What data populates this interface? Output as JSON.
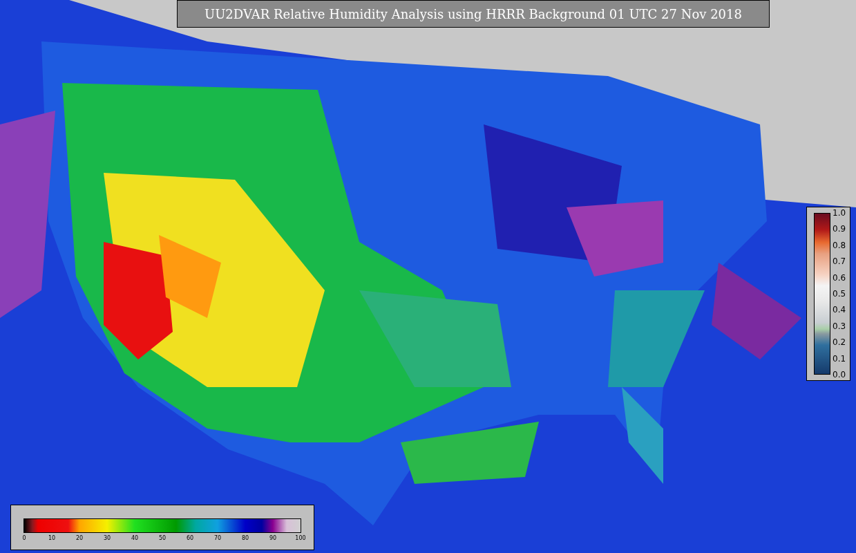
{
  "title": "UU2DVAR Relative Humidity Analysis using HRRR Background 01 UTC 27 Nov 2018",
  "right_legend": {
    "ticks": [
      "1.0",
      "0.9",
      "0.8",
      "0.7",
      "0.6",
      "0.5",
      "0.4",
      "0.3",
      "0.2",
      "0.1",
      "0.0"
    ]
  },
  "bottom_legend": {
    "ticks": [
      "0",
      "10",
      "20",
      "30",
      "40",
      "50",
      "60",
      "70",
      "80",
      "90",
      "100"
    ]
  }
}
